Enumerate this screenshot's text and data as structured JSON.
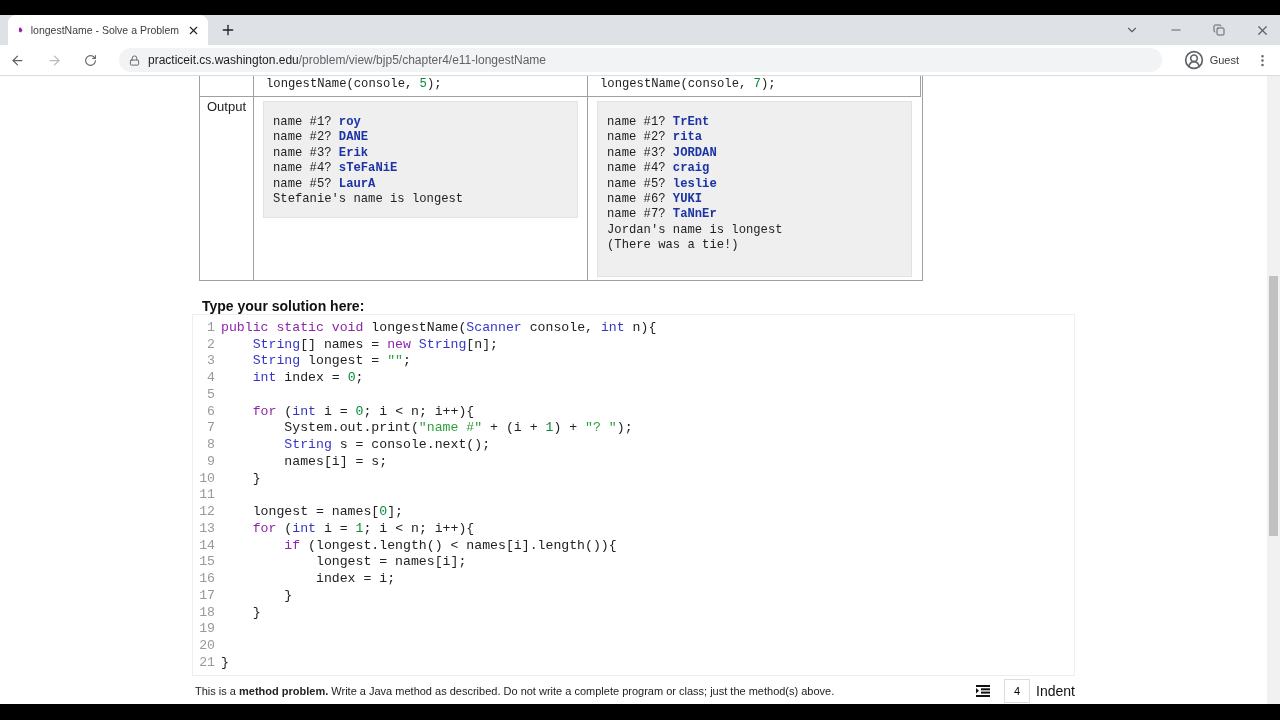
{
  "browser": {
    "tab_title": "longestName - Solve a Problem",
    "url_host": "practiceit.cs.washington.edu",
    "url_path": "/problem/view/bjp5/chapter4/e11-longestName",
    "profile_label": "Guest"
  },
  "examples": {
    "calls": [
      [
        {
          "t": "longestName(console, ",
          "kind": "plain"
        },
        {
          "t": "5",
          "kind": "num"
        },
        {
          "t": ");",
          "kind": "plain"
        }
      ],
      [
        {
          "t": "longestName(console, ",
          "kind": "plain"
        },
        {
          "t": "7",
          "kind": "num"
        },
        {
          "t": ");",
          "kind": "plain"
        }
      ]
    ],
    "output_label": "Output",
    "outputs": [
      [
        {
          "prompt": "name #1? ",
          "input": "roy"
        },
        {
          "prompt": "name #2? ",
          "input": "DANE"
        },
        {
          "prompt": "name #3? ",
          "input": "Erik"
        },
        {
          "prompt": "name #4? ",
          "input": "sTeFaNiE"
        },
        {
          "prompt": "name #5? ",
          "input": "LaurA"
        },
        {
          "prompt": "Stefanie's name is longest"
        }
      ],
      [
        {
          "prompt": "name #1? ",
          "input": "TrEnt"
        },
        {
          "prompt": "name #2? ",
          "input": "rita"
        },
        {
          "prompt": "name #3? ",
          "input": "JORDAN"
        },
        {
          "prompt": "name #4? ",
          "input": "craig"
        },
        {
          "prompt": "name #5? ",
          "input": "leslie"
        },
        {
          "prompt": "name #6? ",
          "input": "YUKI"
        },
        {
          "prompt": "name #7? ",
          "input": "TaNnEr"
        },
        {
          "prompt": "Jordan's name is longest"
        },
        {
          "prompt": "(There was a tie!)"
        }
      ]
    ]
  },
  "solution": {
    "heading": "Type your solution here:",
    "lines": [
      {
        "number": "1",
        "tokens": [
          {
            "t": "public static void",
            "kind": "kw"
          },
          {
            "t": " longestName(",
            "kind": "plain"
          },
          {
            "t": "Scanner",
            "kind": "type"
          },
          {
            "t": " console, ",
            "kind": "plain"
          },
          {
            "t": "int",
            "kind": "type"
          },
          {
            "t": " n){",
            "kind": "plain"
          }
        ]
      },
      {
        "number": "2",
        "tokens": [
          {
            "t": "    String",
            "kind": "type"
          },
          {
            "t": "[] names = ",
            "kind": "plain"
          },
          {
            "t": "new ",
            "kind": "kw"
          },
          {
            "t": "String",
            "kind": "type"
          },
          {
            "t": "[n];",
            "kind": "plain"
          }
        ]
      },
      {
        "number": "3",
        "tokens": [
          {
            "t": "    String",
            "kind": "type"
          },
          {
            "t": " longest = ",
            "kind": "plain"
          },
          {
            "t": "\"\"",
            "kind": "str"
          },
          {
            "t": ";",
            "kind": "plain"
          }
        ]
      },
      {
        "number": "4",
        "tokens": [
          {
            "t": "    int",
            "kind": "type"
          },
          {
            "t": " index = ",
            "kind": "plain"
          },
          {
            "t": "0",
            "kind": "num"
          },
          {
            "t": ";",
            "kind": "plain"
          }
        ]
      },
      {
        "number": "5"
      },
      {
        "number": "6",
        "tokens": [
          {
            "t": "    for",
            "kind": "kw"
          },
          {
            "t": " (",
            "kind": "plain"
          },
          {
            "t": "int",
            "kind": "type"
          },
          {
            "t": " i = ",
            "kind": "plain"
          },
          {
            "t": "0",
            "kind": "num"
          },
          {
            "t": "; i < n; i++){",
            "kind": "plain"
          }
        ]
      },
      {
        "number": "7",
        "tokens": [
          {
            "t": "        System.out.print(",
            "kind": "plain"
          },
          {
            "t": "\"name #\"",
            "kind": "str"
          },
          {
            "t": " + (i + ",
            "kind": "plain"
          },
          {
            "t": "1",
            "kind": "num"
          },
          {
            "t": ") + ",
            "kind": "plain"
          },
          {
            "t": "\"? \"",
            "kind": "str"
          },
          {
            "t": ");",
            "kind": "plain"
          }
        ]
      },
      {
        "number": "8",
        "tokens": [
          {
            "t": "        String",
            "kind": "type"
          },
          {
            "t": " s = console.next();",
            "kind": "plain"
          }
        ]
      },
      {
        "number": "9",
        "tokens": [
          {
            "t": "        names[i] = s;",
            "kind": "plain"
          }
        ]
      },
      {
        "number": "10",
        "tokens": [
          {
            "t": "    }",
            "kind": "plain"
          }
        ]
      },
      {
        "number": "11"
      },
      {
        "number": "12",
        "tokens": [
          {
            "t": "    longest = names[",
            "kind": "plain"
          },
          {
            "t": "0",
            "kind": "num"
          },
          {
            "t": "];",
            "kind": "plain"
          }
        ]
      },
      {
        "number": "13",
        "tokens": [
          {
            "t": "    for",
            "kind": "kw"
          },
          {
            "t": " (",
            "kind": "plain"
          },
          {
            "t": "int",
            "kind": "type"
          },
          {
            "t": " i = ",
            "kind": "plain"
          },
          {
            "t": "1",
            "kind": "num"
          },
          {
            "t": "; i < n; i++){",
            "kind": "plain"
          }
        ]
      },
      {
        "number": "14",
        "tokens": [
          {
            "t": "        if",
            "kind": "kw"
          },
          {
            "t": " (longest.length() < names[i].length()){",
            "kind": "plain"
          }
        ]
      },
      {
        "number": "15",
        "tokens": [
          {
            "t": "            longest = names[i];",
            "kind": "plain"
          }
        ]
      },
      {
        "number": "16",
        "tokens": [
          {
            "t": "            index = i;",
            "kind": "plain"
          }
        ]
      },
      {
        "number": "17",
        "tokens": [
          {
            "t": "        }",
            "kind": "plain"
          }
        ]
      },
      {
        "number": "18",
        "tokens": [
          {
            "t": "    }",
            "kind": "plain"
          }
        ]
      },
      {
        "number": "19"
      },
      {
        "number": "20"
      },
      {
        "number": "21",
        "tokens": [
          {
            "t": "}",
            "kind": "plain"
          }
        ]
      }
    ],
    "note": "This is a **method problem.** Write a Java method as described. Do not write a complete program or class; just the method(s) above.",
    "indent": {
      "value": "4",
      "label": "Indent"
    }
  }
}
